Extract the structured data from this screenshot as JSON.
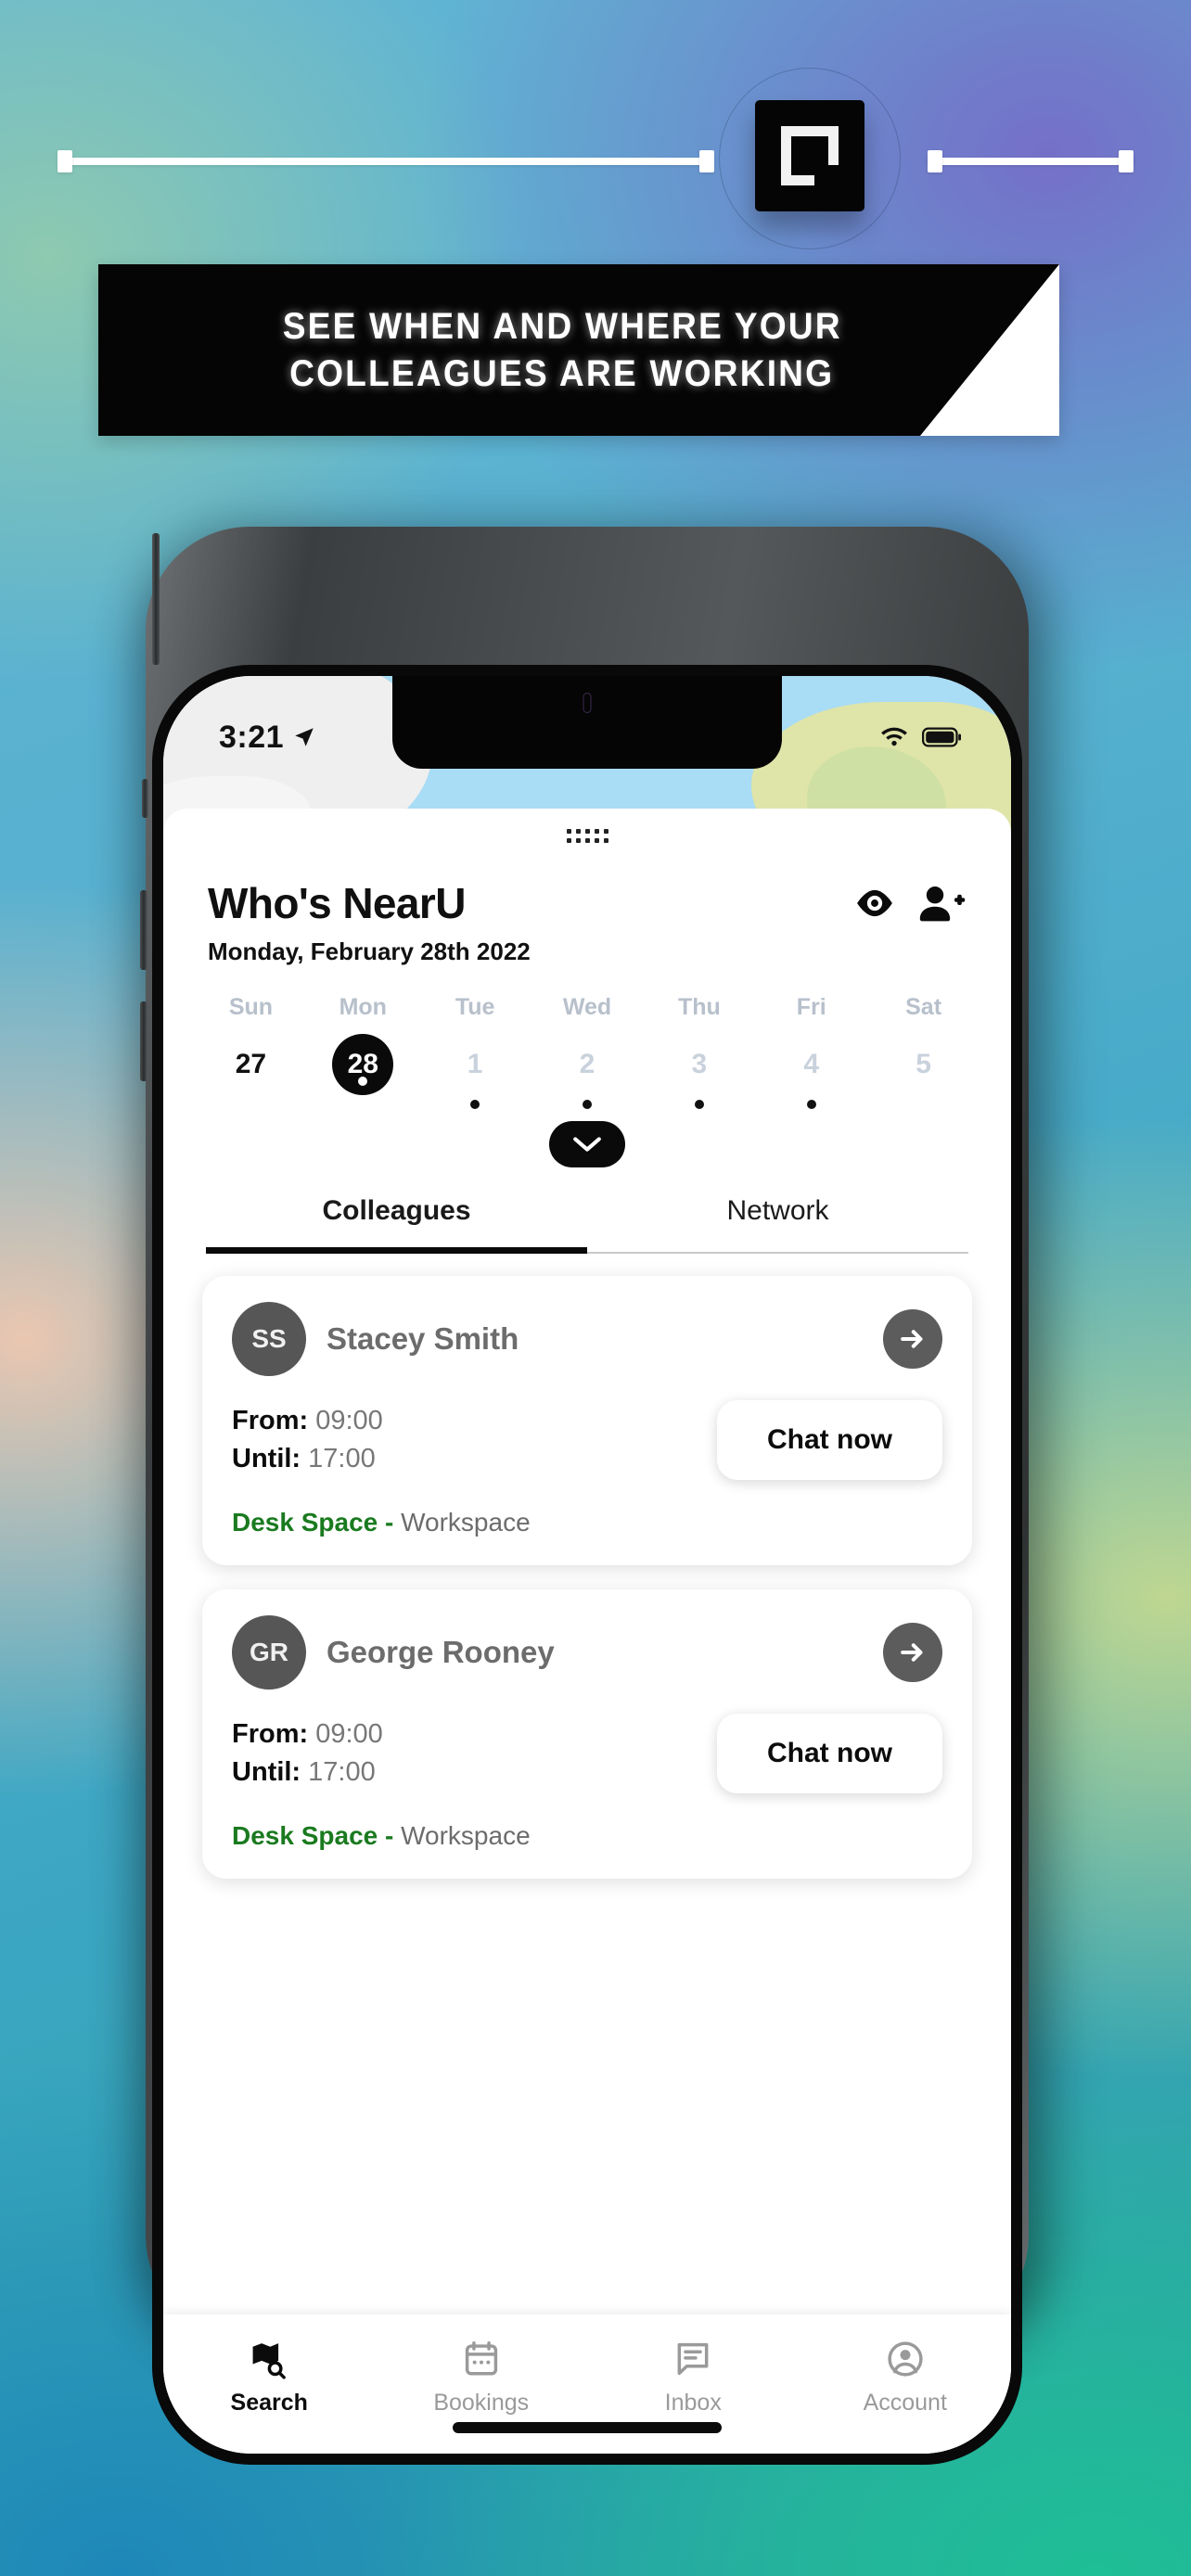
{
  "promo": {
    "headline_line1": "SEE WHEN AND WHERE YOUR",
    "headline_line2": "COLLEAGUES ARE WORKING",
    "logo_name": "app-logo-mark",
    "accent_black": "#050505",
    "accent_white": "#ffffff"
  },
  "status_bar": {
    "time": "3:21",
    "location_icon": "location-arrow-icon",
    "wifi_icon": "wifi-icon",
    "battery_icon": "battery-icon"
  },
  "header": {
    "title": "Who's NearU",
    "date": "Monday, February 28th 2022",
    "visibility_icon": "eye-icon",
    "add_person_icon": "person-add-icon",
    "grabber": "drag-handle-dots"
  },
  "calendar": {
    "day_names": [
      "Sun",
      "Mon",
      "Tue",
      "Wed",
      "Thu",
      "Fri",
      "Sat"
    ],
    "days": [
      {
        "num": "27",
        "state": "plain",
        "dot": false
      },
      {
        "num": "28",
        "state": "selected",
        "dot": true
      },
      {
        "num": "1",
        "state": "muted",
        "dot": true
      },
      {
        "num": "2",
        "state": "muted",
        "dot": true
      },
      {
        "num": "3",
        "state": "muted",
        "dot": true
      },
      {
        "num": "4",
        "state": "muted",
        "dot": true
      },
      {
        "num": "5",
        "state": "muted",
        "dot": false
      }
    ],
    "expand_icon": "chevron-down-icon"
  },
  "tabs": [
    {
      "label": "Colleagues",
      "active": true
    },
    {
      "label": "Network",
      "active": false
    }
  ],
  "cards": [
    {
      "initials": "SS",
      "name": "Stacey Smith",
      "from_label": "From:",
      "from_value": "09:00",
      "until_label": "Until:",
      "until_value": "17:00",
      "chat_label": "Chat now",
      "space_type": "Desk Space -",
      "space_name": "Workspace",
      "arrow_icon": "arrow-right-icon",
      "space_color": "#1a7a1f"
    },
    {
      "initials": "GR",
      "name": "George Rooney",
      "from_label": "From:",
      "from_value": "09:00",
      "until_label": "Until:",
      "until_value": "17:00",
      "chat_label": "Chat now",
      "space_type": "Desk Space -",
      "space_name": "Workspace",
      "arrow_icon": "arrow-right-icon",
      "space_color": "#1a7a1f"
    }
  ],
  "tabbar": [
    {
      "label": "Search",
      "icon": "map-search-icon",
      "active": true
    },
    {
      "label": "Bookings",
      "icon": "calendar-icon",
      "active": false
    },
    {
      "label": "Inbox",
      "icon": "message-icon",
      "active": false
    },
    {
      "label": "Account",
      "icon": "account-circle-icon",
      "active": false
    }
  ]
}
